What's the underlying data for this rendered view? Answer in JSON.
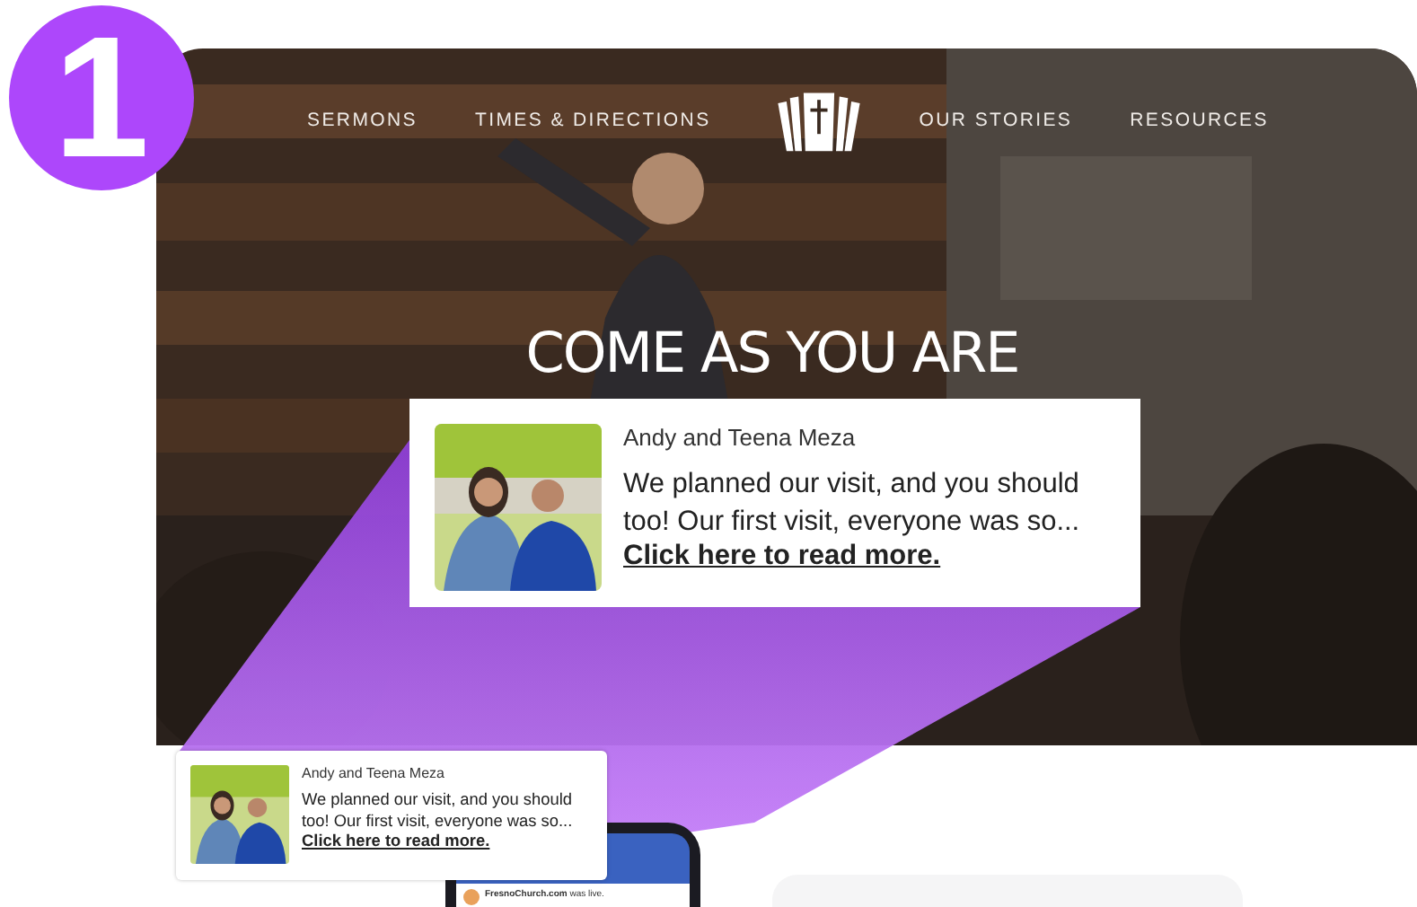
{
  "badge": {
    "number": "1"
  },
  "hero": {
    "nav_left": [
      {
        "label": "SERMONS"
      },
      {
        "label": "TIMES & DIRECTIONS"
      }
    ],
    "nav_right": [
      {
        "label": "OUR STORIES"
      },
      {
        "label": "RESOURCES"
      }
    ],
    "headline": "COME AS YOU ARE"
  },
  "testimonial_large": {
    "name": "Andy and Teena Meza",
    "quote": "We planned our visit, and you should too! Our first visit, everyone was so...",
    "link": "Click here to read more."
  },
  "testimonial_small": {
    "name": "Andy and Teena Meza",
    "quote": "We planned our visit, and you should too! Our first visit, everyone was so...",
    "link": "Click here to read more."
  },
  "phone": {
    "post_author": "FresnoChurch.com",
    "post_text": "was live."
  }
}
